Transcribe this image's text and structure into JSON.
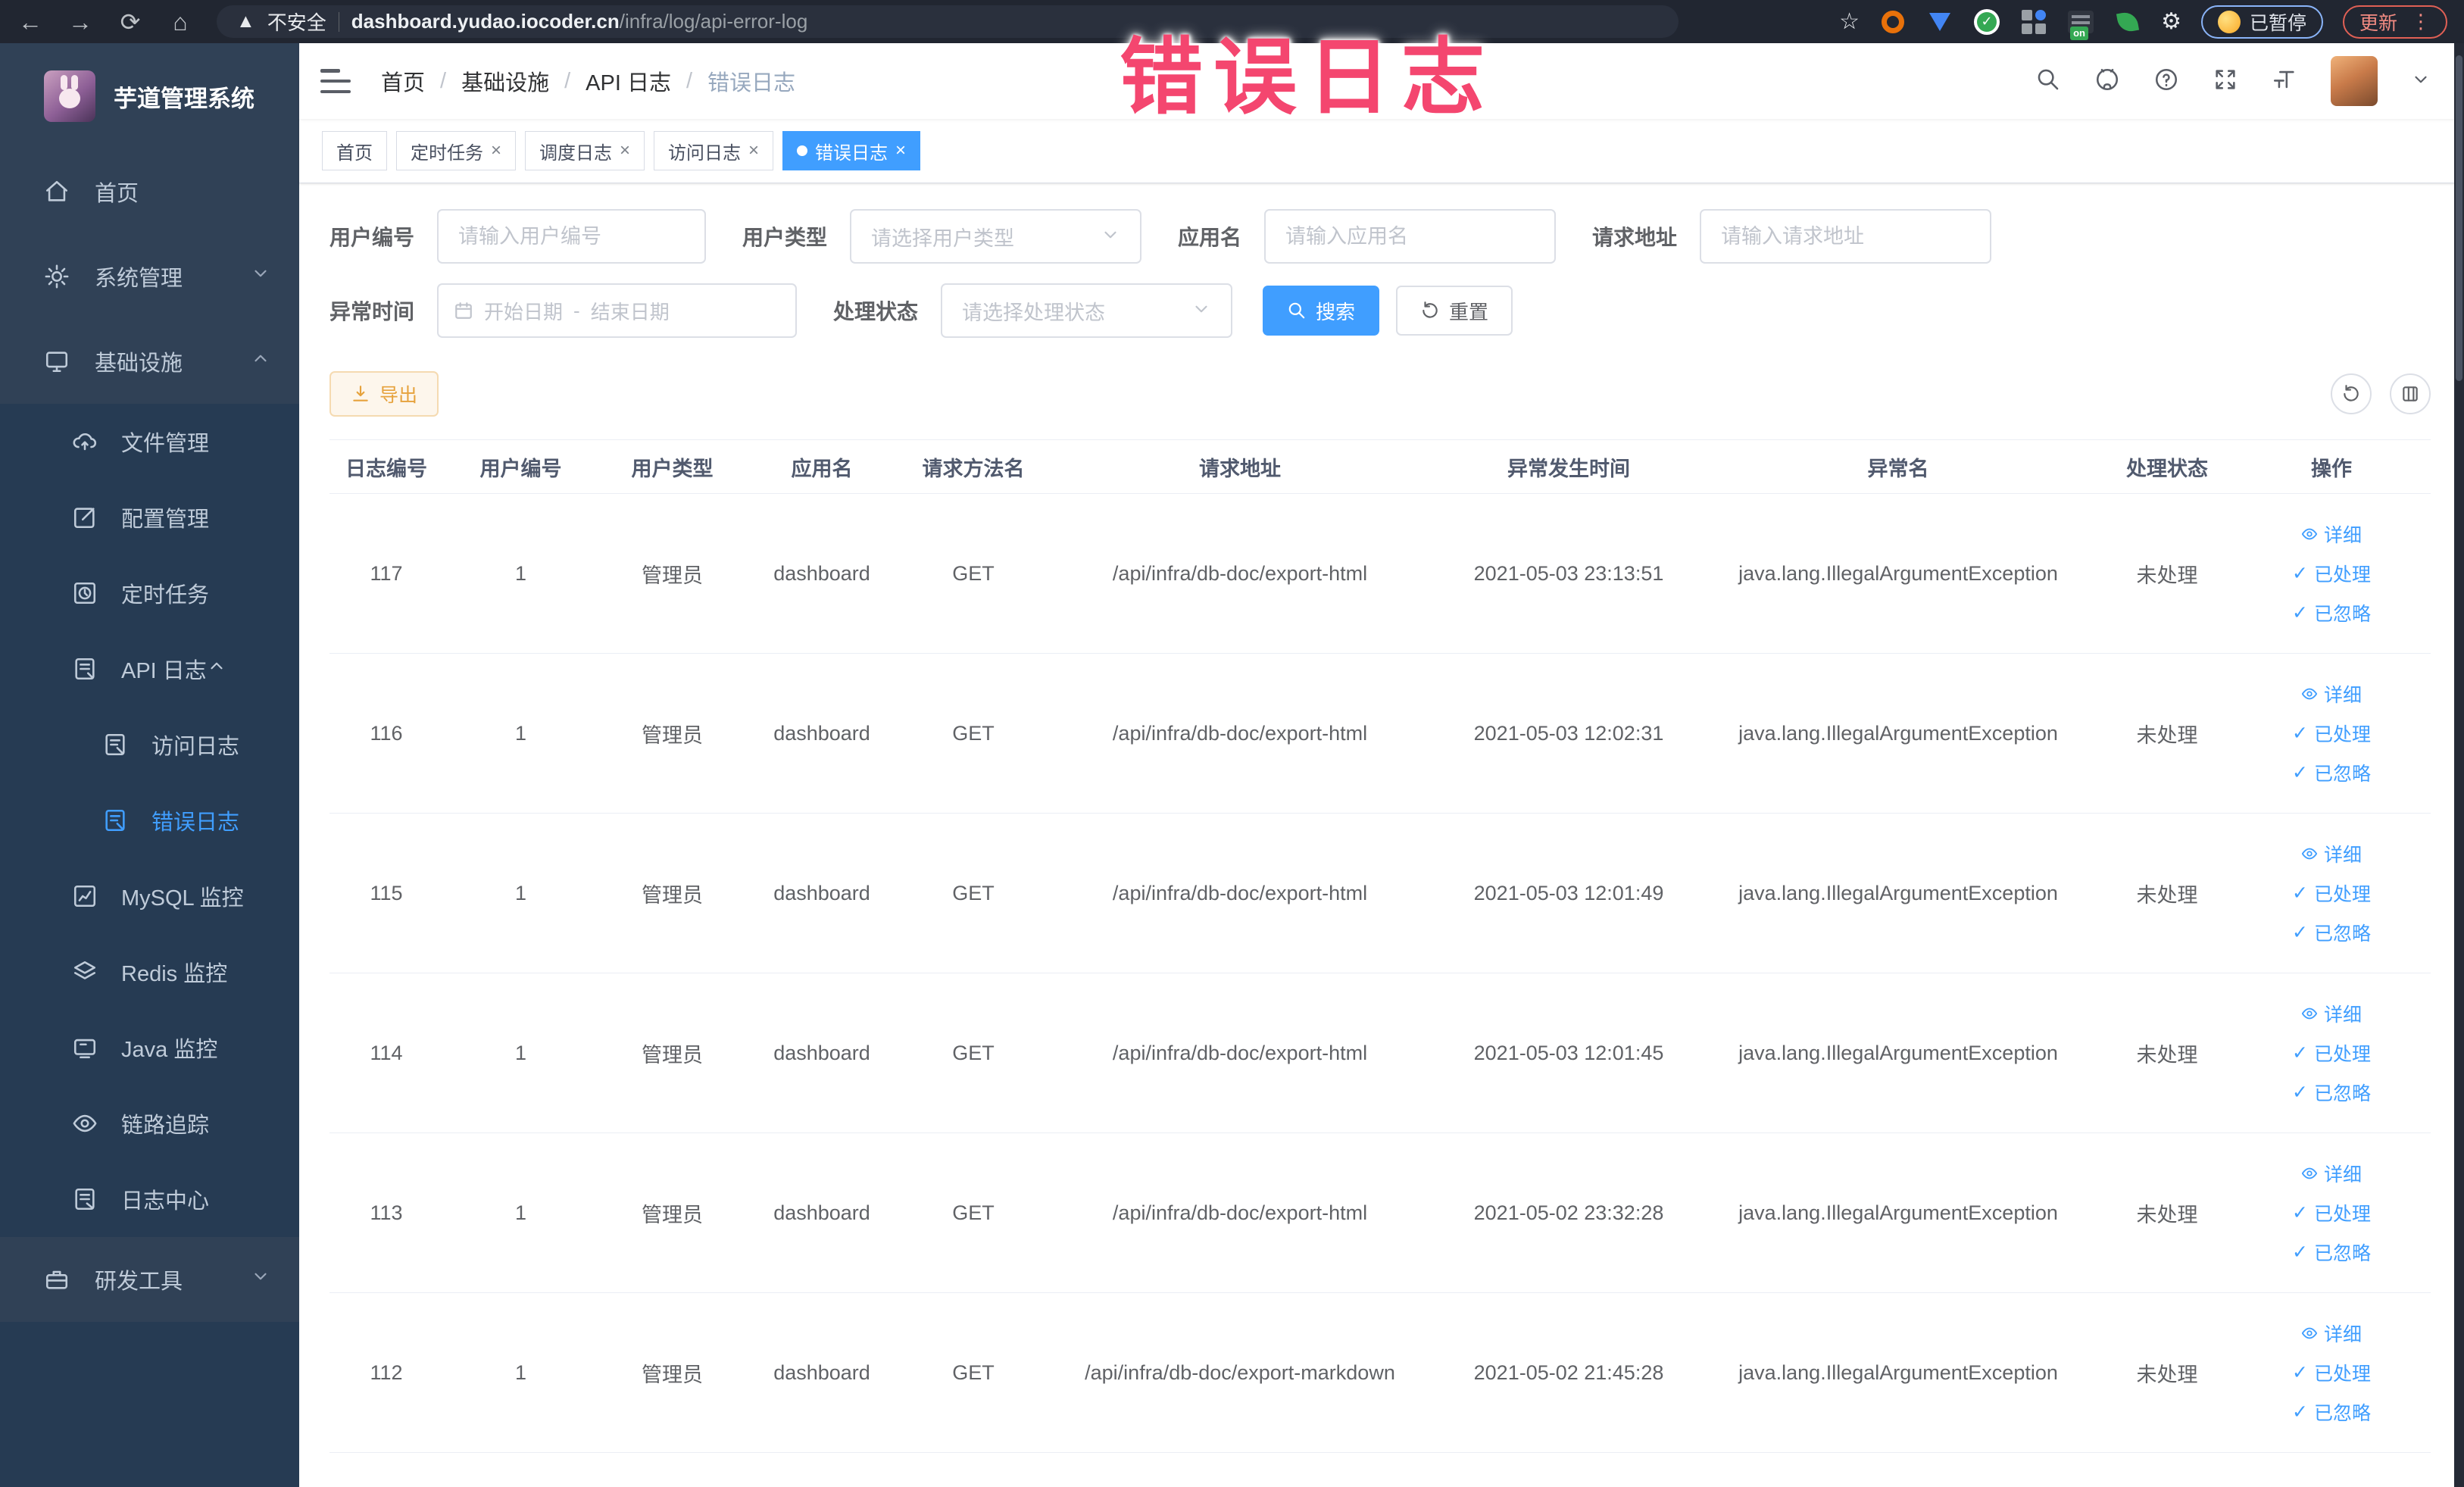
{
  "watermark": "错误日志",
  "browser": {
    "security": "不安全",
    "host": "dashboard.yudao.iocoder.cn",
    "path": "/infra/log/api-error-log",
    "on_badge": "on",
    "paused": "已暂停",
    "update": "更新"
  },
  "sidebar": {
    "title": "芋道管理系统",
    "home": "首页",
    "system": "系统管理",
    "infra": "基础设施",
    "file": "文件管理",
    "config": "配置管理",
    "job": "定时任务",
    "api_log": "API 日志",
    "access_log": "访问日志",
    "error_log": "错误日志",
    "mysql": "MySQL 监控",
    "redis": "Redis 监控",
    "java": "Java 监控",
    "trace": "链路追踪",
    "log_center": "日志中心",
    "dev_tools": "研发工具"
  },
  "header": {
    "breadcrumb": [
      "首页",
      "基础设施",
      "API 日志",
      "错误日志"
    ]
  },
  "tabs": [
    {
      "label": "首页"
    },
    {
      "label": "定时任务"
    },
    {
      "label": "调度日志"
    },
    {
      "label": "访问日志"
    },
    {
      "label": "错误日志"
    }
  ],
  "filters": {
    "user_id_label": "用户编号",
    "user_id_placeholder": "请输入用户编号",
    "user_type_label": "用户类型",
    "user_type_placeholder": "请选择用户类型",
    "app_name_label": "应用名",
    "app_name_placeholder": "请输入应用名",
    "req_url_label": "请求地址",
    "req_url_placeholder": "请输入请求地址",
    "time_label": "异常时间",
    "time_start": "开始日期",
    "time_sep": "-",
    "time_end": "结束日期",
    "status_label": "处理状态",
    "status_placeholder": "请选择处理状态",
    "search": "搜索",
    "reset": "重置"
  },
  "toolbar": {
    "export": "导出"
  },
  "table": {
    "headers": [
      "日志编号",
      "用户编号",
      "用户类型",
      "应用名",
      "请求方法名",
      "请求地址",
      "异常发生时间",
      "异常名",
      "处理状态",
      "操作"
    ],
    "actions": {
      "detail": "详细",
      "processed": "已处理",
      "ignored": "已忽略"
    },
    "rows": [
      {
        "id": "117",
        "user_id": "1",
        "user_type": "管理员",
        "app": "dashboard",
        "method": "GET",
        "url": "/api/infra/db-doc/export-html",
        "time": "2021-05-03 23:13:51",
        "exception": "java.lang.IllegalArgumentException",
        "status": "未处理"
      },
      {
        "id": "116",
        "user_id": "1",
        "user_type": "管理员",
        "app": "dashboard",
        "method": "GET",
        "url": "/api/infra/db-doc/export-html",
        "time": "2021-05-03 12:02:31",
        "exception": "java.lang.IllegalArgumentException",
        "status": "未处理"
      },
      {
        "id": "115",
        "user_id": "1",
        "user_type": "管理员",
        "app": "dashboard",
        "method": "GET",
        "url": "/api/infra/db-doc/export-html",
        "time": "2021-05-03 12:01:49",
        "exception": "java.lang.IllegalArgumentException",
        "status": "未处理"
      },
      {
        "id": "114",
        "user_id": "1",
        "user_type": "管理员",
        "app": "dashboard",
        "method": "GET",
        "url": "/api/infra/db-doc/export-html",
        "time": "2021-05-03 12:01:45",
        "exception": "java.lang.IllegalArgumentException",
        "status": "未处理"
      },
      {
        "id": "113",
        "user_id": "1",
        "user_type": "管理员",
        "app": "dashboard",
        "method": "GET",
        "url": "/api/infra/db-doc/export-html",
        "time": "2021-05-02 23:32:28",
        "exception": "java.lang.IllegalArgumentException",
        "status": "未处理"
      },
      {
        "id": "112",
        "user_id": "1",
        "user_type": "管理员",
        "app": "dashboard",
        "method": "GET",
        "url": "/api/infra/db-doc/export-markdown",
        "time": "2021-05-02 21:45:28",
        "exception": "java.lang.IllegalArgumentException",
        "status": "未处理"
      }
    ]
  },
  "colors": {
    "accent": "#409EFF",
    "warning": "#E6A23C",
    "watermark": "#F4466F",
    "sidebar_bg": "#304156",
    "submenu_bg": "#263B53"
  }
}
